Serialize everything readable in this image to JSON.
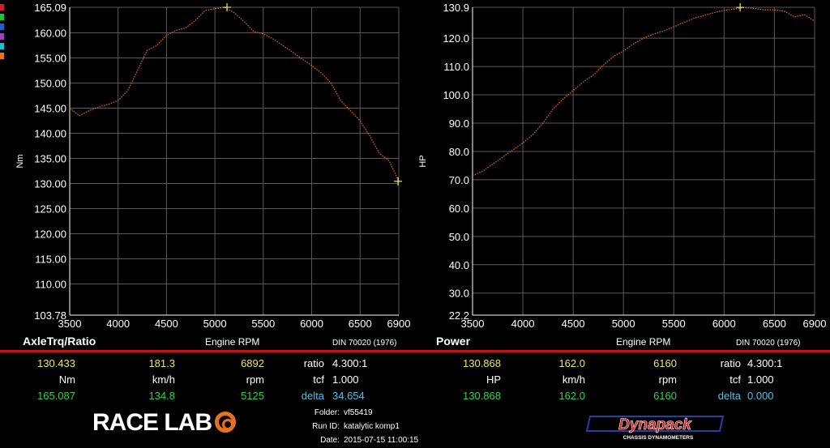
{
  "chart_data": [
    {
      "type": "line",
      "title": "AxleTrq/Ratio",
      "xlabel": "Engine RPM",
      "ylabel": "Nm",
      "standard": "DIN 70020 (1976)",
      "xlim": [
        3500,
        6900
      ],
      "ylim": [
        103.78,
        165.09
      ],
      "xticks": [
        "3500",
        "4000",
        "4500",
        "5000",
        "5500",
        "6000",
        "6500",
        "6900"
      ],
      "yticks": [
        "165.09",
        "160.00",
        "155.00",
        "150.00",
        "145.00",
        "140.00",
        "135.00",
        "130.00",
        "125.00",
        "120.00",
        "115.00",
        "110.00",
        "103.78"
      ],
      "grid": true,
      "series": [
        {
          "color": "#e8711b",
          "x": [
            3500,
            3600,
            3700,
            3800,
            3900,
            4000,
            4100,
            4200,
            4300,
            4400,
            4500,
            4600,
            4700,
            4800,
            4900,
            5000,
            5100,
            5200,
            5300,
            5400,
            5500,
            5600,
            5700,
            5800,
            5900,
            6000,
            6100,
            6200,
            6300,
            6400,
            6500,
            6600,
            6700,
            6800,
            6900
          ],
          "y": [
            145.0,
            143.5,
            144.5,
            145.2,
            145.8,
            146.5,
            148.5,
            152.5,
            156.5,
            157.5,
            159.5,
            160.5,
            161.0,
            162.5,
            164.5,
            164.8,
            165.09,
            164.0,
            162.3,
            160.3,
            159.8,
            158.8,
            157.5,
            156.2,
            154.8,
            153.5,
            152.0,
            150.0,
            146.5,
            144.5,
            142.5,
            139.5,
            136.0,
            134.5,
            130.43
          ]
        }
      ],
      "markers": [
        {
          "x": 5125,
          "y": 165.087
        },
        {
          "x": 6892,
          "y": 130.433
        }
      ]
    },
    {
      "type": "line",
      "title": "Power",
      "xlabel": "Engine RPM",
      "ylabel": "HP",
      "standard": "DIN 70020 (1976)",
      "xlim": [
        3500,
        6900
      ],
      "ylim": [
        22.2,
        130.9
      ],
      "xticks": [
        "3500",
        "4000",
        "4500",
        "5000",
        "5500",
        "6000",
        "6500",
        "6900"
      ],
      "yticks": [
        "130.9",
        "120.0",
        "110.0",
        "100.0",
        "90.0",
        "80.0",
        "70.0",
        "60.0",
        "50.0",
        "40.0",
        "30.0",
        "22.2"
      ],
      "grid": true,
      "series": [
        {
          "color": "#e8711b",
          "x": [
            3500,
            3600,
            3700,
            3800,
            3900,
            4000,
            4100,
            4200,
            4300,
            4400,
            4500,
            4600,
            4700,
            4800,
            4900,
            5000,
            5100,
            5200,
            5300,
            5400,
            5500,
            5600,
            5700,
            5800,
            5900,
            6000,
            6100,
            6200,
            6300,
            6400,
            6500,
            6600,
            6700,
            6800,
            6900
          ],
          "y": [
            71.5,
            73.0,
            75.5,
            78.0,
            80.5,
            83.0,
            86.0,
            90.0,
            95.0,
            98.5,
            101.5,
            104.5,
            107.0,
            110.5,
            113.5,
            115.5,
            118.0,
            120.0,
            121.5,
            122.5,
            124.0,
            125.5,
            127.0,
            128.0,
            129.0,
            129.8,
            130.3,
            130.8,
            130.5,
            130.0,
            130.0,
            129.5,
            127.5,
            128.3,
            126.0
          ]
        }
      ],
      "markers": [
        {
          "x": 6160,
          "y": 130.868
        }
      ]
    }
  ],
  "left_readout": {
    "row1": {
      "a": "130.433",
      "b": "181.3",
      "c": "6892",
      "label": "ratio",
      "value": "4.300:1"
    },
    "row2": {
      "a": "Nm",
      "b": "km/h",
      "c": "rpm",
      "label": "tcf",
      "value": "1.000"
    },
    "row3": {
      "a": "165.087",
      "b": "134.8",
      "c": "5125",
      "label": "delta",
      "value": "34.654"
    }
  },
  "right_readout": {
    "row1": {
      "a": "130.868",
      "b": "162.0",
      "c": "6160",
      "label": "ratio",
      "value": "4.300:1"
    },
    "row2": {
      "a": "HP",
      "b": "km/h",
      "c": "rpm",
      "label": "tcf",
      "value": "1.000"
    },
    "row3": {
      "a": "130.868",
      "b": "162.0",
      "c": "6160",
      "label": "delta",
      "value": "0.000"
    }
  },
  "run_info": {
    "folder_label": "Folder:",
    "folder": "vf55419",
    "run_label": "Run ID:",
    "run": "katalytic komp1",
    "date_label": "Date:",
    "date": "2015-07-15 11:00:15"
  },
  "logos": {
    "racelab": "RACE LAB",
    "dynapack": "Dynapack",
    "dynapack_sub": "CHASSIS DYNAMOMETERS"
  },
  "legend_colors": [
    "#d0202a",
    "#20c040",
    "#2060d0",
    "#a040c0",
    "#20c0d0",
    "#e8711b"
  ]
}
